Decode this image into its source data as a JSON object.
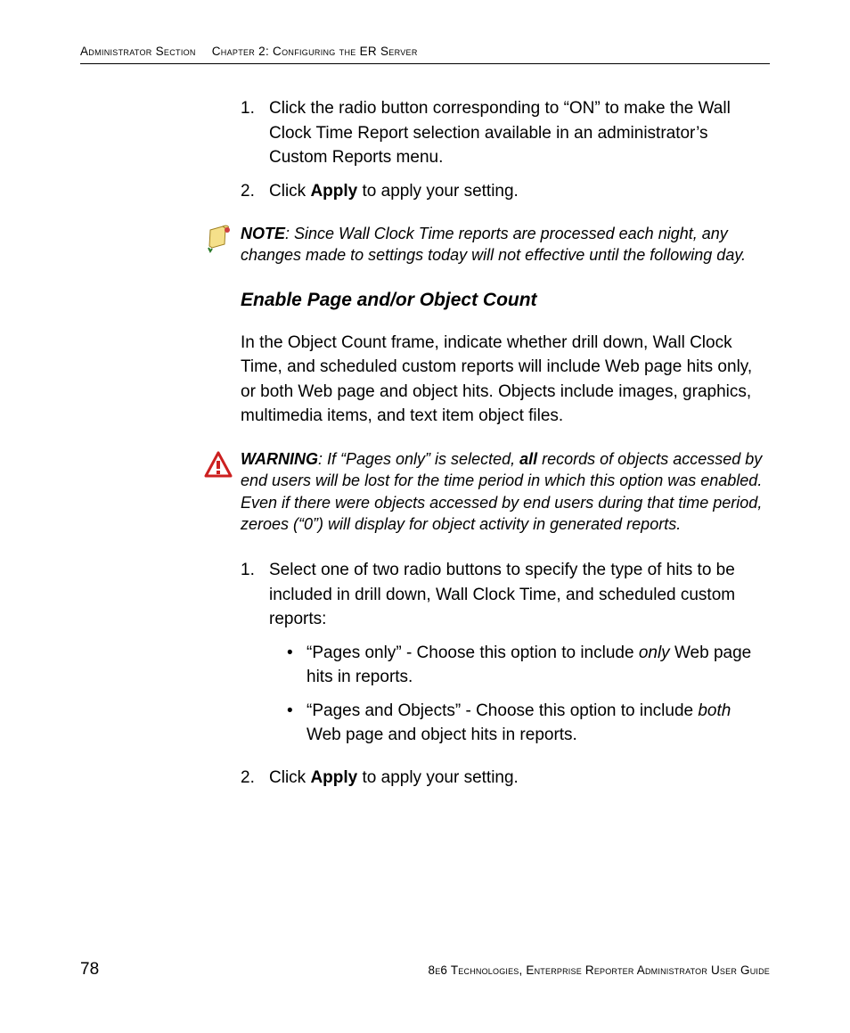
{
  "header": {
    "section": "Administrator Section",
    "chapter": "Chapter 2: Configuring the ER Server"
  },
  "step1_num": "1.",
  "step1_text": "Click the radio button corresponding to “ON” to make the Wall Clock Time Report selection available in an administrator’s Custom Reports menu.",
  "step2_num": "2.",
  "step2_pre": "Click ",
  "step2_bold": "Apply",
  "step2_post": " to apply your setting.",
  "note_label": "NOTE",
  "note_text": ": Since Wall Clock Time reports are processed each night, any changes made to settings today will not effective until the following day.",
  "subhead": "Enable Page and/or Object Count",
  "para1": "In the Object Count frame, indicate whether drill down, Wall Clock Time, and scheduled custom reports will include Web page hits only, or both Web page and object hits. Objects include images, graphics, multimedia items, and text item object files.",
  "warn_label": "WARNING",
  "warn_pre": ": If “Pages only” is selected, ",
  "warn_bold": "all",
  "warn_post": " records of objects accessed by end users will be lost for the time period in which this option was enabled. Even if there were objects accessed by end users during that time period, zeroes (“0”) will display for object activity in generated reports.",
  "s1_num": "1.",
  "s1_text": "Select one of two radio buttons to specify the type of hits to be included in drill down, Wall Clock Time, and scheduled custom reports:",
  "b1_pre": "“Pages only” - Choose this option to include ",
  "b1_em": "only",
  "b1_post": " Web page hits in reports.",
  "b2_pre": "“Pages and Objects” - Choose this option to include ",
  "b2_em": "both",
  "b2_post": " Web page and object hits in reports.",
  "s2_num": "2.",
  "s2_pre": "Click ",
  "s2_bold": "Apply",
  "s2_post": " to apply your setting.",
  "footer": {
    "page": "78",
    "text": "8e6 Technologies, Enterprise Reporter Administrator User Guide"
  }
}
